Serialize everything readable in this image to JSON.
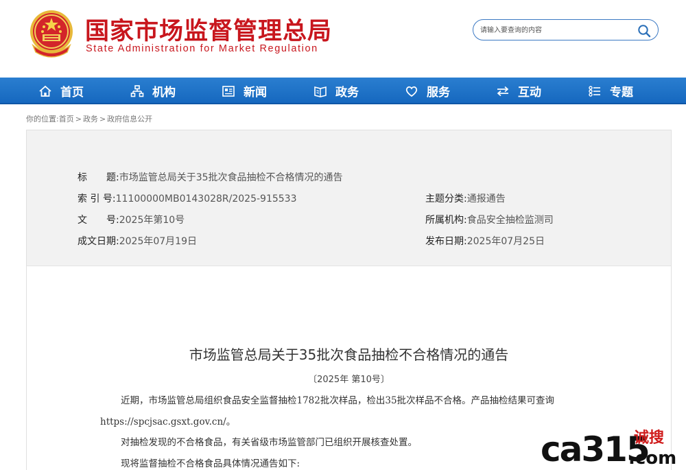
{
  "header": {
    "logo_cn": "国家市场监督管理总局",
    "logo_en": "State Administration for Market Regulation",
    "search_placeholder": "请输入要查询的内容",
    "emblem_icon": "national-emblem-icon",
    "search_icon": "search-icon"
  },
  "nav": {
    "items": [
      {
        "label": "首页",
        "icon": "home-icon"
      },
      {
        "label": "机构",
        "icon": "org-chart-icon"
      },
      {
        "label": "新闻",
        "icon": "newspaper-icon"
      },
      {
        "label": "政务",
        "icon": "book-icon"
      },
      {
        "label": "服务",
        "icon": "heart-icon"
      },
      {
        "label": "互动",
        "icon": "exchange-arrows-icon"
      },
      {
        "label": "专题",
        "icon": "list-icon"
      }
    ]
  },
  "breadcrumb": {
    "prefix": "你的位置:",
    "items": [
      "首页",
      "政务",
      "政府信息公开"
    ],
    "separator": ">"
  },
  "meta": {
    "title_key": "标　　题:",
    "title_val": "市场监管总局关于35批次食品抽检不合格情况的通告",
    "index_key": "索 引 号:",
    "index_val": "11100000MB0143028R/2025-915533",
    "topic_key": "主题分类:",
    "topic_val": "通报通告",
    "docno_key": "文　　号:",
    "docno_val": "2025年第10号",
    "dept_key": "所属机构:",
    "dept_val": "食品安全抽检监测司",
    "made_key": "成文日期:",
    "made_val": "2025年07月19日",
    "pub_key": "发布日期:",
    "pub_val": "2025年07月25日"
  },
  "article": {
    "title": "市场监管总局关于35批次食品抽检不合格情况的通告",
    "doc_no": "〔2025年 第10号〕",
    "para1_a": "近期，市场监管总局组织食品安全监督抽检1782批次样品，检出35批次样品不合格。产品抽检结果可查询",
    "para1_link": "https://spcjsac.gsxt.gov.cn/",
    "para1_end": "。",
    "para2": "对抽检发现的不合格食品，有关省级市场监管部门已组织开展核查处置。",
    "para3": "现将监督抽检不合格食品具体情况通告如下:"
  },
  "watermark": {
    "latin": "ca315",
    "cn": "诚搜",
    "domain": ".com"
  },
  "colors": {
    "brand_red": "#c8161d",
    "nav_blue": "#1a6fc4",
    "meta_bg": "#f2f2f2"
  }
}
